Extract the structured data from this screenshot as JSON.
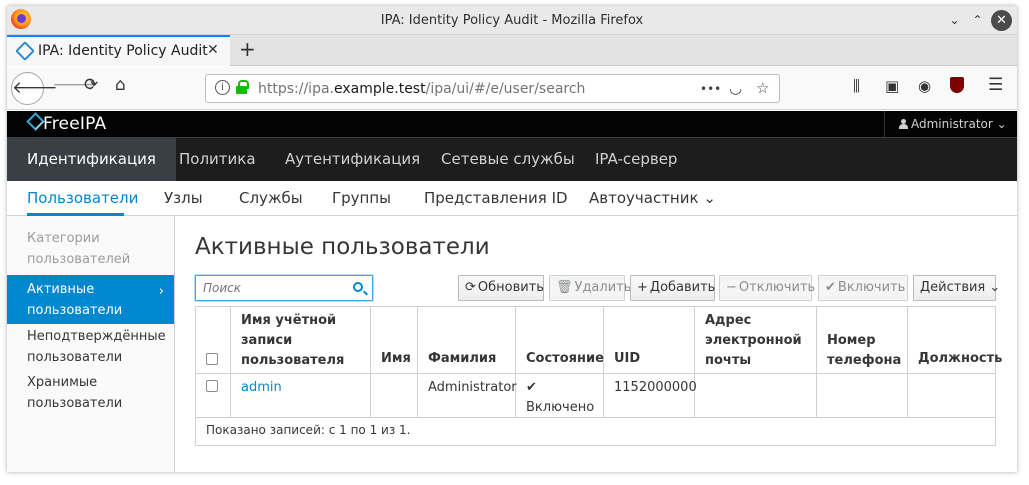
{
  "window": {
    "title": "IPA: Identity Policy Audit - Mozilla Firefox",
    "minimize_glyph": "⌄",
    "maximize_glyph": "⌃",
    "close_glyph": "✕"
  },
  "browser": {
    "tab_title": "IPA: Identity Policy Audit",
    "tab_close_glyph": "✕",
    "new_tab_glyph": "+",
    "url_prefix": "https://ipa.",
    "url_domain": "example.test",
    "url_path": "/ipa/ui/#/e/user/search",
    "page_actions_glyph": "•••"
  },
  "header": {
    "logo": "FreeIPA",
    "user": "Administrator",
    "user_caret": "⌄"
  },
  "primary_nav": [
    {
      "label": "Идентификация",
      "active": true
    },
    {
      "label": "Политика"
    },
    {
      "label": "Аутентификация"
    },
    {
      "label": "Сетевые службы"
    },
    {
      "label": "IPA-сервер"
    }
  ],
  "secondary_nav": [
    {
      "label": "Пользователи",
      "active": true
    },
    {
      "label": "Узлы"
    },
    {
      "label": "Службы"
    },
    {
      "label": "Группы"
    },
    {
      "label": "Представления ID"
    },
    {
      "label": "Автоучастник ⌄"
    }
  ],
  "sidebar": {
    "heading_line1": "Категории",
    "heading_line2": "пользователей",
    "items": [
      {
        "line1": "Активные",
        "line2": "пользователи",
        "active": true
      },
      {
        "line1": "Неподтверждённые",
        "line2": "пользователи"
      },
      {
        "line1": "Хранимые",
        "line2": "пользователи"
      }
    ]
  },
  "page": {
    "title": "Активные пользователи",
    "search_placeholder": "Поиск"
  },
  "toolbar": {
    "refresh": "Обновить",
    "delete": "Удалить",
    "add": "Добавить",
    "disable": "Отключить",
    "enable": "Включить",
    "actions": "Действия ⌄"
  },
  "table": {
    "headers": {
      "login_l1": "Имя учётной",
      "login_l2": "записи",
      "login_l3": "пользователя",
      "first": "Имя",
      "last": "Фамилия",
      "status": "Состояние",
      "uid": "UID",
      "email_l1": "Адрес",
      "email_l2": "электронной",
      "email_l3": "почты",
      "phone_l1": "Номер",
      "phone_l2": "телефона",
      "title": "Должность"
    },
    "rows": [
      {
        "login": "admin",
        "first": "",
        "last": "Administrator",
        "status_icon": "✔",
        "status": "Включено",
        "uid": "1152000000",
        "email": "",
        "phone": "",
        "title": ""
      }
    ],
    "footer": "Показано записей: с 1 по 1 из 1."
  },
  "colors": {
    "accent": "#0088ce",
    "masthead": "#030303",
    "primary_nav_bg": "#1d1d1d",
    "primary_nav_active": "#393f44"
  }
}
